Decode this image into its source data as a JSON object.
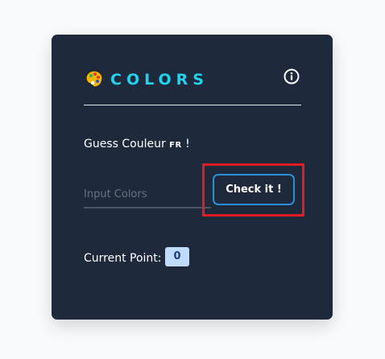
{
  "header": {
    "title": "COLORS",
    "logo_icon": "palette-icon",
    "info_icon": "info-icon"
  },
  "prompt": {
    "text": "Guess Couleur ",
    "lang": "FR",
    "suffix": " !"
  },
  "input": {
    "placeholder": "Input Colors",
    "value": ""
  },
  "button": {
    "label": "Check it !"
  },
  "score": {
    "label": "Current Point:",
    "value": "0"
  },
  "colors": {
    "background": "#f8fafc",
    "card": "#1e293b",
    "title": "#22d3ee",
    "button_border": "#2b8fd6",
    "highlight": "#e41b23",
    "badge": "#bfdbfe"
  }
}
